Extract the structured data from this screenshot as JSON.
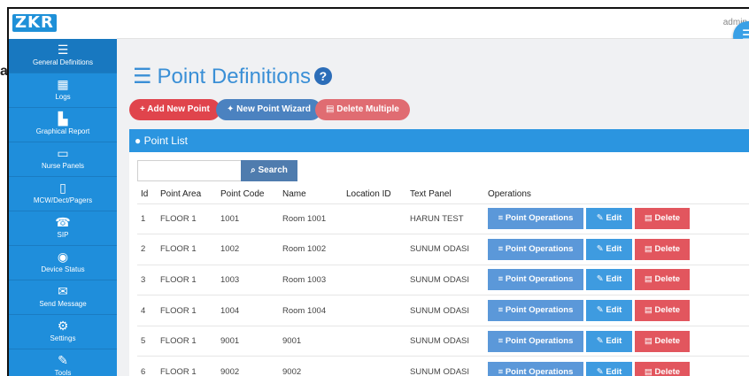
{
  "app": {
    "logo": "ZKR",
    "user": "admin",
    "outer_label": "a"
  },
  "sidebar": {
    "items": [
      {
        "label": "General Definitions",
        "icon": "list-icon"
      },
      {
        "label": "Logs",
        "icon": "table-icon"
      },
      {
        "label": "Graphical Report",
        "icon": "bar-chart-icon"
      },
      {
        "label": "Nurse Panels",
        "icon": "monitor-icon"
      },
      {
        "label": "MCW/Dect/Pagers",
        "icon": "mobile-icon"
      },
      {
        "label": "SIP",
        "icon": "phone-icon"
      },
      {
        "label": "Device Status",
        "icon": "dashboard-icon"
      },
      {
        "label": "Send Message",
        "icon": "envelope-icon"
      },
      {
        "label": "Settings",
        "icon": "gears-icon"
      },
      {
        "label": "Tools",
        "icon": "wrench-icon"
      }
    ]
  },
  "page": {
    "title": "Point Definitions"
  },
  "toolbar": {
    "add_label": "+ Add New Point",
    "wizard_label": "New Point Wizard",
    "delete_multiple_label": "Delete Multiple"
  },
  "panel": {
    "title": "Point List"
  },
  "search": {
    "placeholder": "",
    "button_label": "Search"
  },
  "table": {
    "headers": [
      "Id",
      "Point Area",
      "Point Code",
      "Name",
      "Location ID",
      "Text Panel",
      "Operations"
    ],
    "rows": [
      {
        "id": "1",
        "area": "FLOOR 1",
        "code": "1001",
        "name": "Room 1001",
        "location": "",
        "text_panel": "HARUN TEST"
      },
      {
        "id": "2",
        "area": "FLOOR 1",
        "code": "1002",
        "name": "Room 1002",
        "location": "",
        "text_panel": "SUNUM ODASI"
      },
      {
        "id": "3",
        "area": "FLOOR 1",
        "code": "1003",
        "name": "Room 1003",
        "location": "",
        "text_panel": "SUNUM ODASI"
      },
      {
        "id": "4",
        "area": "FLOOR 1",
        "code": "1004",
        "name": "Room 1004",
        "location": "",
        "text_panel": "SUNUM ODASI"
      },
      {
        "id": "5",
        "area": "FLOOR 1",
        "code": "9001",
        "name": "9001",
        "location": "",
        "text_panel": "SUNUM ODASI"
      },
      {
        "id": "6",
        "area": "FLOOR 1",
        "code": "9002",
        "name": "9002",
        "location": "",
        "text_panel": "SUNUM ODASI"
      }
    ],
    "operations": {
      "points_label": "Point Operations",
      "edit_label": "Edit",
      "delete_label": "Delete"
    }
  },
  "colors": {
    "sidebar": "#1f8edb",
    "accent": "#3a8fd6",
    "danger": "#e0444c",
    "panel_head": "#2b95e0"
  }
}
